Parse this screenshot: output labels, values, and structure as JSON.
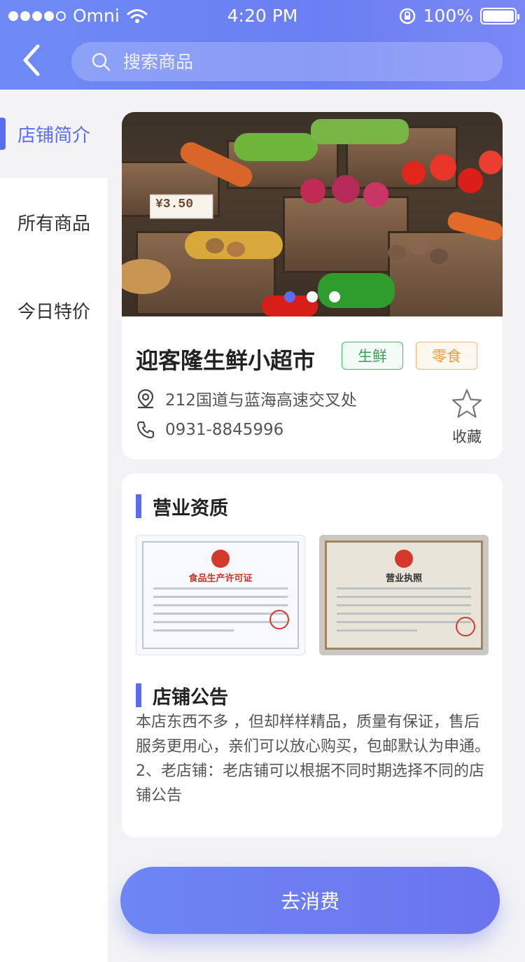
{
  "status_bar": {
    "carrier": "Omni",
    "time": "4:20 PM",
    "battery": "100%",
    "signal_dots_filled": 4,
    "icons": [
      "signal-dots-icon",
      "wifi-icon",
      "rotation-lock-icon",
      "battery-icon"
    ]
  },
  "search": {
    "placeholder": "搜索商品"
  },
  "sidebar": {
    "items": [
      {
        "label": "店铺简介",
        "active": true
      },
      {
        "label": "所有商品",
        "active": false
      },
      {
        "label": "今日特价",
        "active": false
      }
    ]
  },
  "store": {
    "name": "迎客隆生鲜小超市",
    "tags": [
      {
        "label": "生鲜",
        "color": "#3f9d5b"
      },
      {
        "label": "零食",
        "color": "#ef9b3a"
      }
    ],
    "address": "212国道与蓝海高速交叉处",
    "phone": "0931-8845996",
    "favorite_label": "收藏",
    "banner_dots": {
      "count": 3,
      "active_index": 0
    },
    "banner_price_signs": [
      "¥3.50",
      "¥3.50"
    ]
  },
  "qualification": {
    "title": "营业资质",
    "certificates": [
      {
        "title": "食品生产许可证"
      },
      {
        "title": "营业执照"
      }
    ]
  },
  "announcement": {
    "title": "店铺公告",
    "text": "本店东西不多 ，但却样样精品，质量有保证，售后服务更用心，亲们可以放心购买，包邮默认为申通。2、老店铺：老店铺可以根据不同时期选择不同的店铺公告"
  },
  "cta": {
    "label": "去消费"
  },
  "colors": {
    "accent": "#5b6cf0",
    "header": "#6f8af6"
  }
}
